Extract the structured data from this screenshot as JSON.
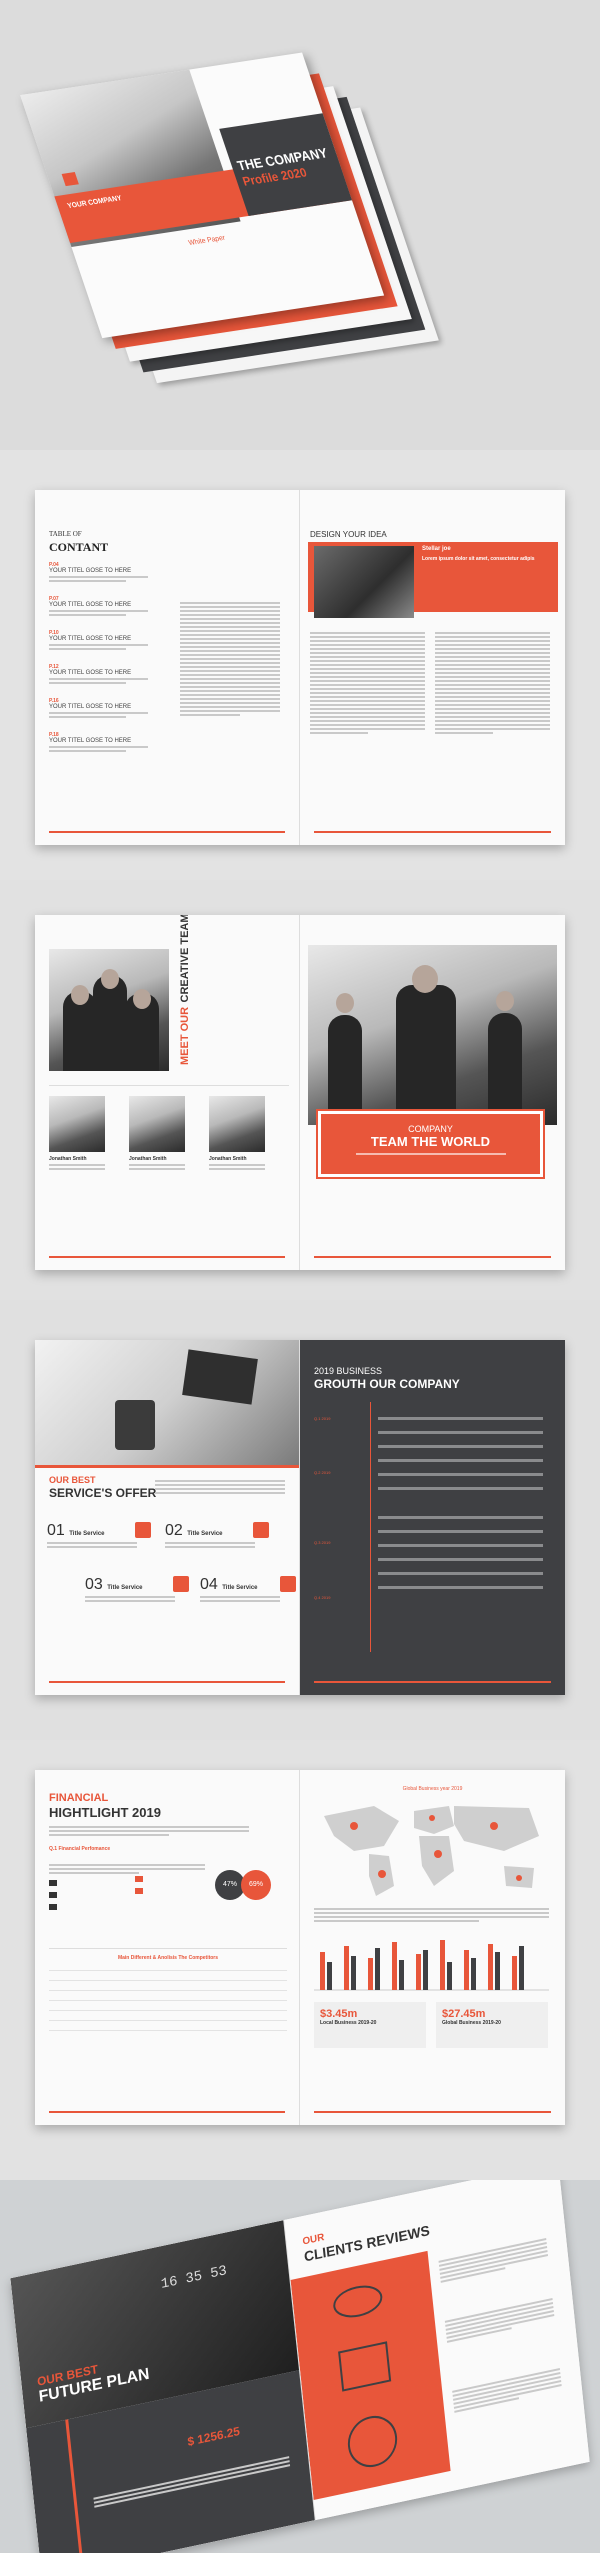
{
  "cover": {
    "brand": "YOUR COMPANY",
    "title_line1": "THE COMPANY",
    "title_line2": "Profile 2020",
    "subtitle": "White Paper"
  },
  "toc": {
    "label": "TABLE OF",
    "heading": "CONTANT",
    "items": [
      {
        "page": "P.04",
        "title": "YOUR TITEL GOSE TO HERE"
      },
      {
        "page": "P.07",
        "title": "YOUR TITEL GOSE TO HERE"
      },
      {
        "page": "P.10",
        "title": "YOUR TITEL GOSE TO HERE"
      },
      {
        "page": "P.12",
        "title": "YOUR TITEL GOSE TO HERE"
      },
      {
        "page": "P.16",
        "title": "YOUR TITEL GOSE TO HERE"
      },
      {
        "page": "P.18",
        "title": "YOUR TITEL GOSE TO HERE"
      }
    ],
    "design_heading": "DESIGN YOUR IDEA",
    "person_name": "Stellar joe",
    "lead_text": "Lorem ipsum dolor sit amet, consectetur adipis"
  },
  "team": {
    "vertical_title_1": "MEET OUR",
    "vertical_title_2": "CREATIVE TEAM",
    "members": [
      "Jonathan Smith",
      "Jonathan Smith",
      "Jonathan Smith"
    ],
    "banner_line1": "COMPANY",
    "banner_line2": "TEAM THE WORLD"
  },
  "services": {
    "heading_line1": "OUR BEST",
    "heading_line2": "SERVICE'S OFFER",
    "items": [
      {
        "num": "01",
        "title": "Title Service"
      },
      {
        "num": "02",
        "title": "Title Service"
      },
      {
        "num": "03",
        "title": "Title Service"
      },
      {
        "num": "04",
        "title": "Title Service"
      }
    ],
    "timeline_heading_1": "2019 BUSINESS",
    "timeline_heading_2": "GROUTH OUR COMPANY",
    "timeline_labels": [
      "Q.1 2019",
      "Q.2 2019",
      "Q.3 2019",
      "Q.4 2019"
    ]
  },
  "financial": {
    "heading_line1": "FINANCIAL",
    "heading_line2": "HIGHTLIGHT 2019",
    "subheading": "Q.1 Financial Perfomance",
    "percent_a": "47%",
    "percent_b": "69%",
    "table_title": "Main Different & Anolisis The Competitors",
    "map_title": "Global Business year 2019",
    "stat_a_value": "$3.45m",
    "stat_a_label": "Local Business 2019-20",
    "stat_b_value": "$27.45m",
    "stat_b_label": "Global Business 2019-20"
  },
  "future": {
    "heading_line1": "OUR BEST",
    "heading_line2": "FUTURE PLAN",
    "clock": "16 35 53",
    "amount": "$ 1256.25",
    "reviews_line1": "OUR",
    "reviews_line2": "CLIENTS REVIEWS"
  },
  "colors": {
    "accent": "#e8563a",
    "dark": "#3f4043"
  }
}
